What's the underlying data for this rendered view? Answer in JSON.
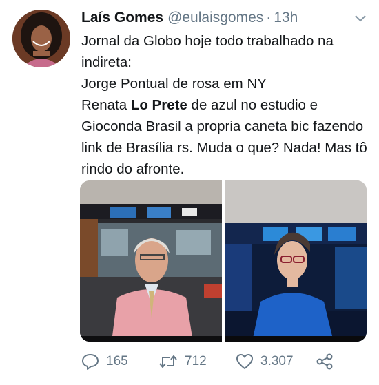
{
  "tweet": {
    "display_name": "Laís Gomes",
    "handle": "@eulaisgomes",
    "separator": "·",
    "time": "13h",
    "lines": {
      "l1": "Jornal da Globo hoje todo trabalhado na indireta:",
      "l2": "Jorge Pontual de rosa em NY",
      "l3_pre": "Renata ",
      "l3_bold": "Lo Prete",
      "l3_post": " de azul no estudio e",
      "l4": "Gioconda Brasil a propria caneta bic fazendo link de Brasília rs. Muda o que? Nada! Mas tô rindo do afronte."
    },
    "counts": {
      "replies": "165",
      "retweets": "712",
      "likes": "3.307"
    }
  },
  "icons": {
    "menu": "chevron-down-icon",
    "reply": "reply-icon",
    "retweet": "retweet-icon",
    "like": "heart-icon",
    "share": "share-icon"
  },
  "colors": {
    "text": "#14171a",
    "secondary": "#657786",
    "suit_pink": "#e8a1a8",
    "dress_blue": "#1e62c8"
  }
}
